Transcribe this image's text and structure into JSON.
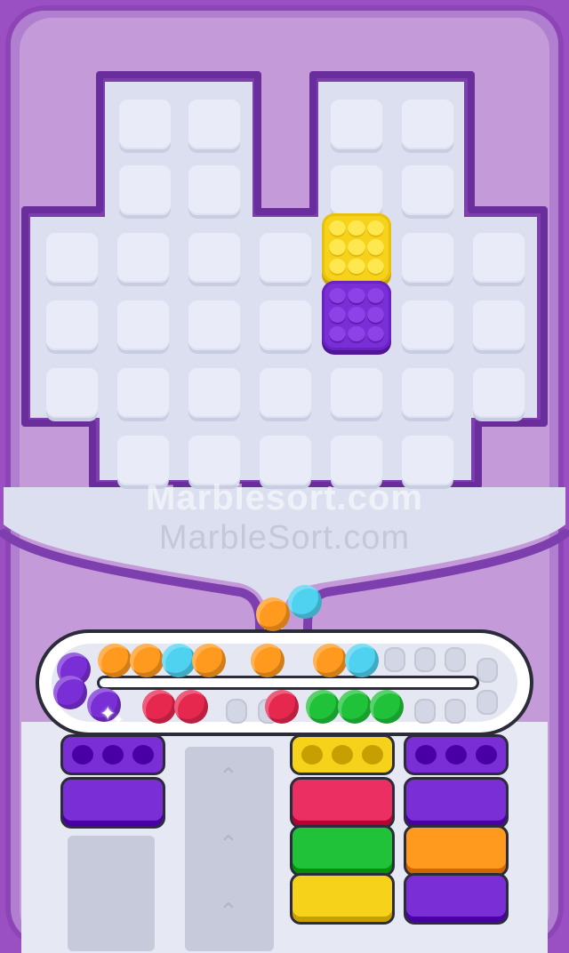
{
  "colors": {
    "background": "#9a4fc2",
    "board": "#dcdff0",
    "cell": "#e9ecf8",
    "yellow": "#f7d21a",
    "purple": "#7a2fd6",
    "orange": "#ff9a1f",
    "cyan": "#4fd2f0",
    "red": "#e6284f",
    "green": "#1fc238",
    "pink": "#ec2f63"
  },
  "watermark": {
    "line1": "Marblesort.com",
    "line2": "MarbleSort.com"
  },
  "board": {
    "blocks": [
      {
        "color": "yellow",
        "label": "yellow-block"
      },
      {
        "color": "purple",
        "label": "purple-block"
      }
    ]
  },
  "queue_marbles": [
    "orange",
    "cyan"
  ],
  "conveyor": {
    "top_row": [
      "purple",
      "orange",
      "orange",
      "cyan",
      "orange",
      "orange",
      "orange",
      "cyan"
    ],
    "bottom_row": [
      "purple",
      "purple",
      "red",
      "red",
      "red",
      "green",
      "green",
      "green"
    ]
  },
  "containers": {
    "left": [
      "purple",
      "purple"
    ],
    "right_a": [
      "yellow",
      "pink",
      "green",
      "yellow"
    ],
    "right_b": [
      "purple",
      "purple",
      "orange",
      "purple"
    ]
  }
}
